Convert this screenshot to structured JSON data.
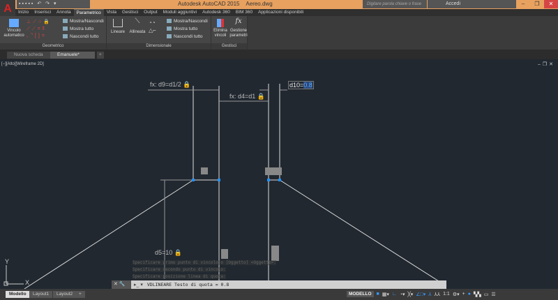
{
  "app": {
    "title": "Autodesk AutoCAD 2015",
    "file": "Aereo.dwg",
    "logo": "A"
  },
  "search": {
    "placeholder": "Digitare parola chiave o frase"
  },
  "login": {
    "label": "Accedi"
  },
  "window": {
    "minimize": "–",
    "restore": "❐",
    "close": "✕"
  },
  "ribbon_tabs": [
    "Inizio",
    "Inserisci",
    "Annota",
    "Parametrico",
    "Vista",
    "Gestisci",
    "Output",
    "Moduli aggiuntivi",
    "Autodesk 360",
    "BIM 360",
    "Applicazioni disponibili"
  ],
  "active_tab": "Parametrico",
  "panels": {
    "geometric": {
      "title": "Geometrico",
      "big": "Vincolo automatico",
      "items": [
        "Mostra/Nascondi",
        "Mostra tutto",
        "Nascondi tutto"
      ]
    },
    "dimensional": {
      "title": "Dimensionale",
      "lineare": "Lineare",
      "allineata": "Allineata",
      "items": [
        "Mostra/Nascondi",
        "Mostra tutto",
        "Nascondi tutto"
      ]
    },
    "manage": {
      "title": "Gestisci",
      "elimina": "Elimina vincoli",
      "gestione": "Gestione parametri"
    }
  },
  "doc_tabs": [
    {
      "label": "Nuova scheda"
    },
    {
      "label": "Emanuele*"
    }
  ],
  "viewport": {
    "label": "[−][Alto][Wireframe 2D]"
  },
  "dimensions": {
    "d9": "fx: d9=d1/2",
    "d4": "fx: d4=d1",
    "d10_name": "d10=",
    "d10_value": "0.8",
    "d5": "d5=10"
  },
  "command": {
    "history": [
      "Specificare primo punto di vincolo o [Oggetto] <Oggetto>:",
      "Specificare secondo punto di vincolo:",
      "Specificare posizione linea di quota:"
    ],
    "current": "VDLINEARE Testo di quota = 0.8"
  },
  "layout_tabs": [
    "Modello",
    "Layout1",
    "Layout2"
  ],
  "status": {
    "model": "MODELLO",
    "scale": "1:1"
  },
  "ucs": {
    "x": "X",
    "y": "Y"
  },
  "colors": {
    "accent_title": "#e8a15f",
    "grip": "#1e90ff",
    "highlight": "#2a4a7a"
  }
}
